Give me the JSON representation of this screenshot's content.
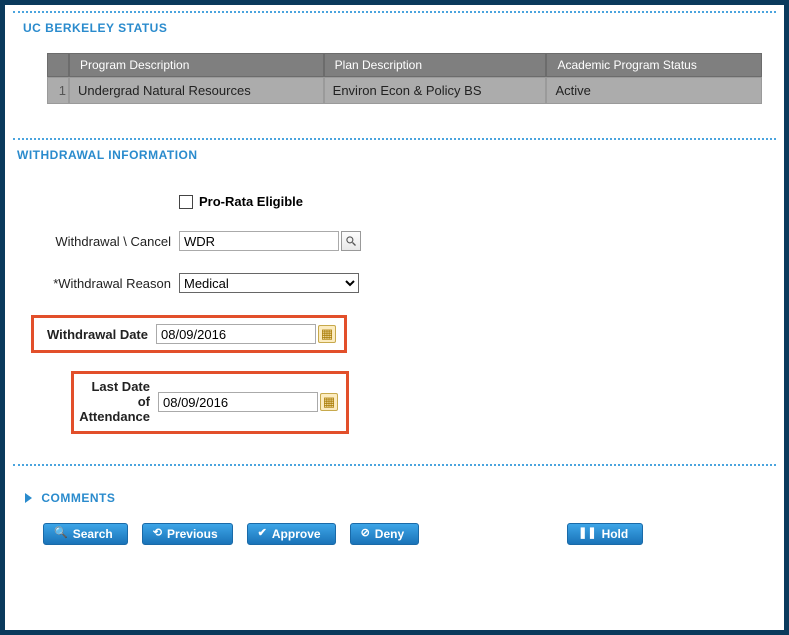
{
  "sections": {
    "status_title": "UC BERKELEY STATUS",
    "withdrawal_title": "WITHDRAWAL INFORMATION",
    "comments_title": "COMMENTS"
  },
  "status_table": {
    "headers": {
      "program": "Program Description",
      "plan": "Plan Description",
      "aps": "Academic Program Status"
    },
    "row": {
      "num": "1",
      "program": "Undergrad Natural Resources",
      "plan": "Environ Econ & Policy BS",
      "aps": "Active"
    }
  },
  "form": {
    "prorata_label": "Pro-Rata Eligible",
    "wc_label": "Withdrawal \\ Cancel",
    "wc_value": "WDR",
    "reason_label": "*Withdrawal Reason",
    "reason_value": "Medical",
    "wdate_label": "Withdrawal Date",
    "wdate_value": "08/09/2016",
    "lda_label_l1": "Last Date of",
    "lda_label_l2": "Attendance",
    "lda_value": "08/09/2016"
  },
  "buttons": {
    "search": "Search",
    "previous": "Previous",
    "approve": "Approve",
    "deny": "Deny",
    "hold": "Hold"
  }
}
